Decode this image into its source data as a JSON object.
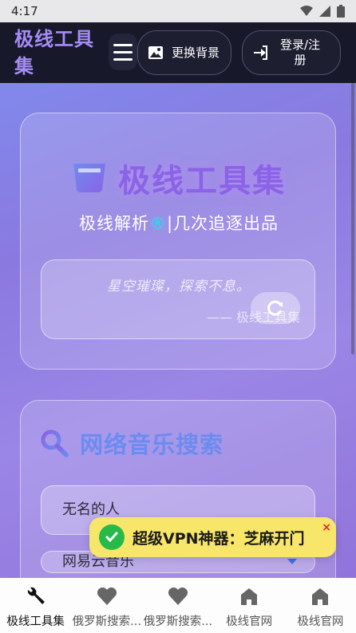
{
  "status_bar": {
    "time": "4:17"
  },
  "header": {
    "brand": "极线工具集",
    "change_bg_label": "更换背景",
    "login_label": "登录/注册"
  },
  "hero": {
    "title": "极线工具集",
    "subtitle_pre": "极线解析",
    "subtitle_mark": "®",
    "subtitle_post": "|几次追逐出品",
    "quote": "星空璀璨，探索不息。",
    "quote_author": "—— 极线工具集"
  },
  "music": {
    "title": "网络音乐搜索",
    "search_value": "无名的人",
    "source_value": "网易云音乐"
  },
  "promo": {
    "text": "超级VPN神器：芝麻开门",
    "close": "×"
  },
  "bottom_nav": {
    "tabs": [
      {
        "label": "极线工具集",
        "icon": "wrench-icon",
        "active": true
      },
      {
        "label": "俄罗斯搜索...",
        "icon": "heart-icon"
      },
      {
        "label": "俄罗斯搜索...",
        "icon": "heart-icon"
      },
      {
        "label": "极线官网",
        "icon": "home-icon"
      },
      {
        "label": "极线官网",
        "icon": "home-icon"
      }
    ]
  },
  "colors": {
    "brand": "#a58cf5",
    "hero_title": "#8a63e6",
    "music_title": "#6a8cf0",
    "registered_mark": "#36d1ef",
    "promo_bg": "#f8e66a",
    "promo_check": "#27b94a",
    "nav_bg": "#17182a"
  }
}
